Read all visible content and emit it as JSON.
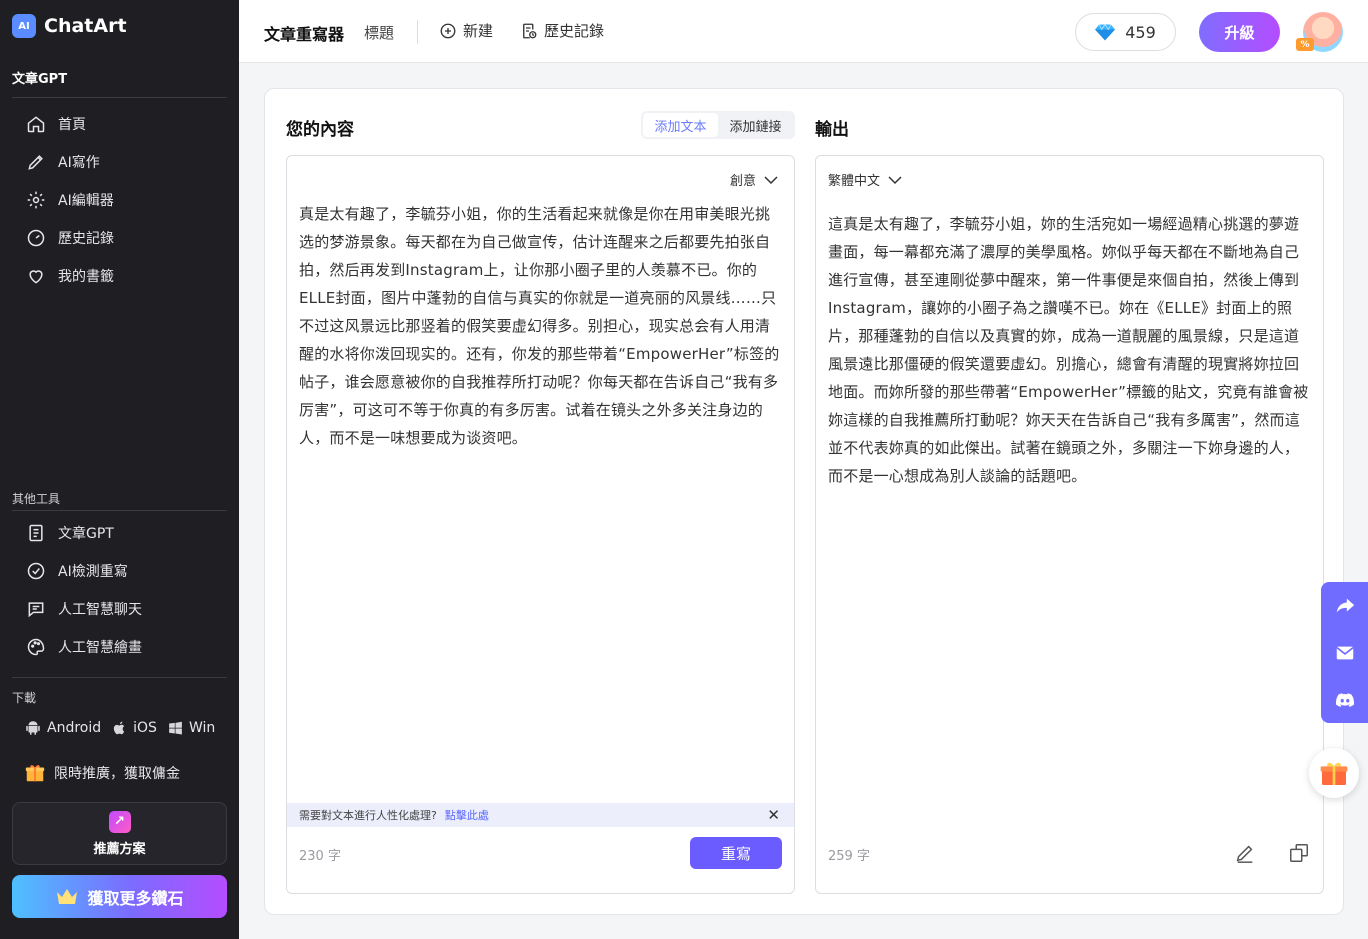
{
  "app": {
    "name": "ChatArt",
    "logo_mark": "AI"
  },
  "sidebar": {
    "section_title": "文章GPT",
    "nav": [
      {
        "label": "首頁",
        "icon": "home-icon"
      },
      {
        "label": "AI寫作",
        "icon": "pencil-icon"
      },
      {
        "label": "AI編輯器",
        "icon": "gear-icon"
      },
      {
        "label": "歷史記錄",
        "icon": "history-icon"
      },
      {
        "label": "我的書籤",
        "icon": "heart-icon"
      }
    ],
    "other_tools_title": "其他工具",
    "tools": [
      {
        "label": "文章GPT",
        "icon": "document-icon"
      },
      {
        "label": "AI檢測重寫",
        "icon": "check-circle-icon"
      },
      {
        "label": "人工智慧聊天",
        "icon": "chat-icon"
      },
      {
        "label": "人工智慧繪畫",
        "icon": "palette-icon"
      }
    ],
    "download_title": "下載",
    "downloads": [
      {
        "label": "Android",
        "icon": "android-icon"
      },
      {
        "label": "iOS",
        "icon": "apple-icon"
      },
      {
        "label": "Win",
        "icon": "windows-icon"
      }
    ],
    "promo_text": "限時推廣，獲取傭金",
    "plan_label": "推薦方案",
    "diamond_button": "獲取更多鑽石"
  },
  "topbar": {
    "title": "文章重寫器",
    "tab": "標題",
    "new_label": "新建",
    "history_label": "歷史記錄",
    "gems": "459",
    "upgrade_label": "升級",
    "avatar_badge": "%"
  },
  "input": {
    "heading": "您的內容",
    "tabs": [
      "添加文本",
      "添加鏈接"
    ],
    "active_tab": 0,
    "mode": "創意",
    "text": "真是太有趣了，李毓芬小姐，你的生活看起来就像是你在用审美眼光挑选的梦游景象。每天都在为自己做宣传，估计连醒来之后都要先拍张自拍，然后再发到Instagram上，让你那小圈子里的人羡慕不已。你的ELLE封面，图片中蓬勃的自信与真实的你就是一道亮丽的风景线……只不过这风景远比那竖着的假笑要虚幻得多。别担心，现实总会有人用清醒的水将你泼回现实的。还有，你发的那些带着“EmpowerHer”标签的帖子，谁会愿意被你的自我推荐所打动呢？你每天都在告诉自己“我有多厉害”，可这可不等于你真的有多厉害。试着在镜头之外多关注身边的人，而不是一味想要成为谈资吧。",
    "notice_text": "需要對文本進行人性化處理?",
    "notice_link": "點擊此處",
    "count": "230 字",
    "rewrite_label": "重寫"
  },
  "output": {
    "heading": "輸出",
    "language": "繁體中文",
    "text": "這真是太有趣了，李毓芬小姐，妳的生活宛如一場經過精心挑選的夢遊畫面，每一幕都充滿了濃厚的美學風格。妳似乎每天都在不斷地為自己進行宣傳，甚至連剛從夢中醒來，第一件事便是來個自拍，然後上傳到Instagram，讓妳的小圈子為之讚嘆不已。妳在《ELLE》封面上的照片，那種蓬勃的自信以及真實的妳，成為一道靚麗的風景線，只是這道風景遠比那僵硬的假笑還要虛幻。別擔心，總會有清醒的現實將妳拉回地面。而妳所發的那些帶著“EmpowerHer”標籤的貼文，究竟有誰會被妳這樣的自我推薦所打動呢？妳天天在告訴自己“我有多厲害”，然而這並不代表妳真的如此傑出。試著在鏡頭之外，多關注一下妳身邊的人，而不是一心想成為別人談論的話題吧。",
    "count": "259 字"
  },
  "floating": {
    "icons": [
      "share-icon",
      "mail-icon",
      "discord-icon"
    ],
    "gift_icon": "gift-icon"
  },
  "colors": {
    "sidebar_bg": "#1f1f23",
    "accent": "#6a5cff",
    "float_bar": "#6f6cff",
    "link": "#5966ff"
  }
}
